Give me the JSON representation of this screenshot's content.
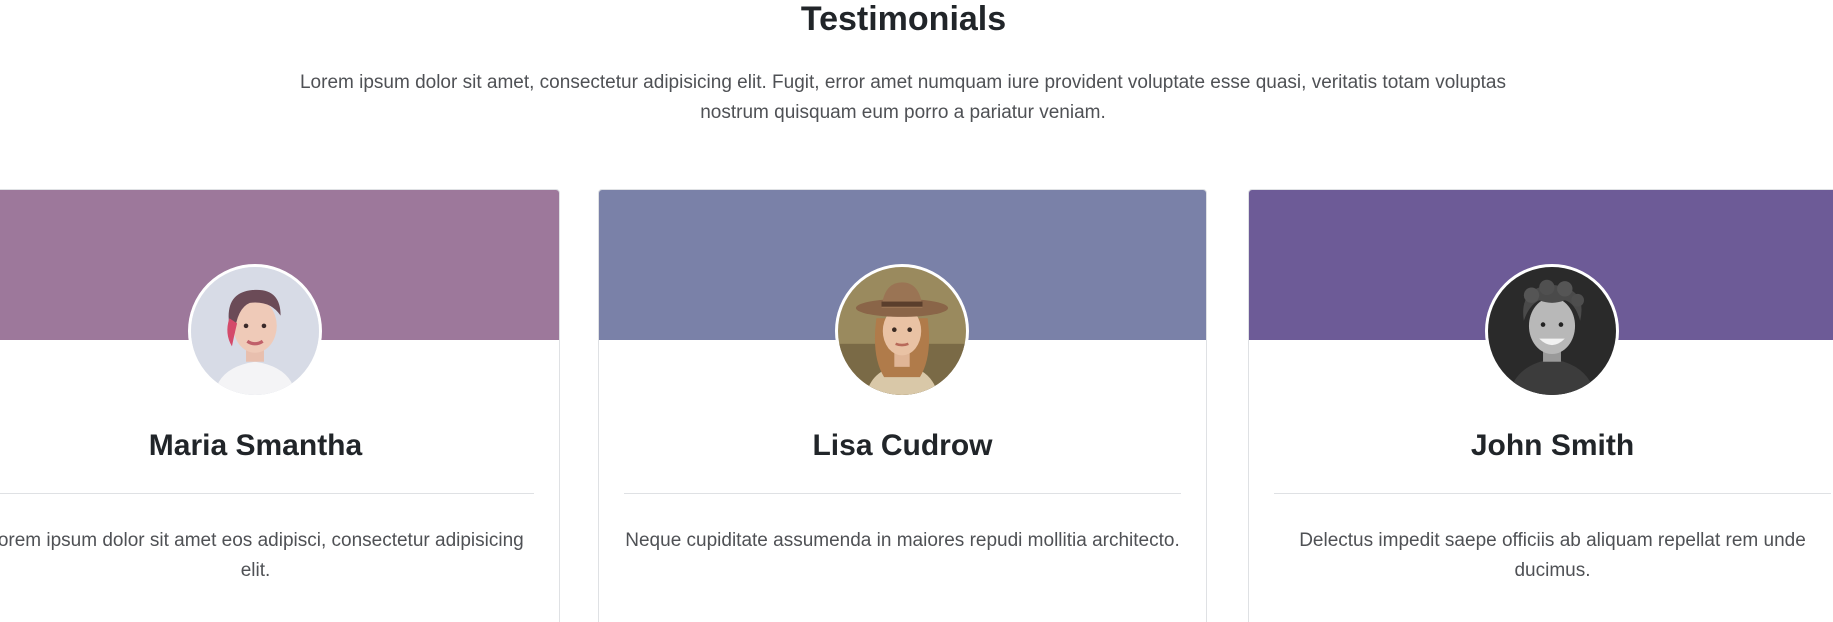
{
  "section": {
    "title": "Testimonials",
    "intro": "Lorem ipsum dolor sit amet, consectetur adipisicing elit. Fugit, error amet numquam iure provident voluptate esse quasi, veritatis totam voluptas nostrum quisquam eum porro a pariatur veniam."
  },
  "testimonials": [
    {
      "name": "Maria Smantha",
      "text": "Lorem ipsum dolor sit amet eos adipisci, consectetur adipisicing elit.",
      "header_color": "#9d789b",
      "avatar_icon": "woman-short-hair-avatar"
    },
    {
      "name": "Lisa Cudrow",
      "text": "Neque cupiditate assumenda in maiores repudi mollitia architecto.",
      "header_color": "#7a81a8",
      "avatar_icon": "woman-hat-avatar"
    },
    {
      "name": "John Smith",
      "text": "Delectus impedit saepe officiis ab aliquam repellat rem unde ducimus.",
      "header_color": "#6d5b97",
      "avatar_icon": "man-curly-hair-avatar"
    }
  ]
}
